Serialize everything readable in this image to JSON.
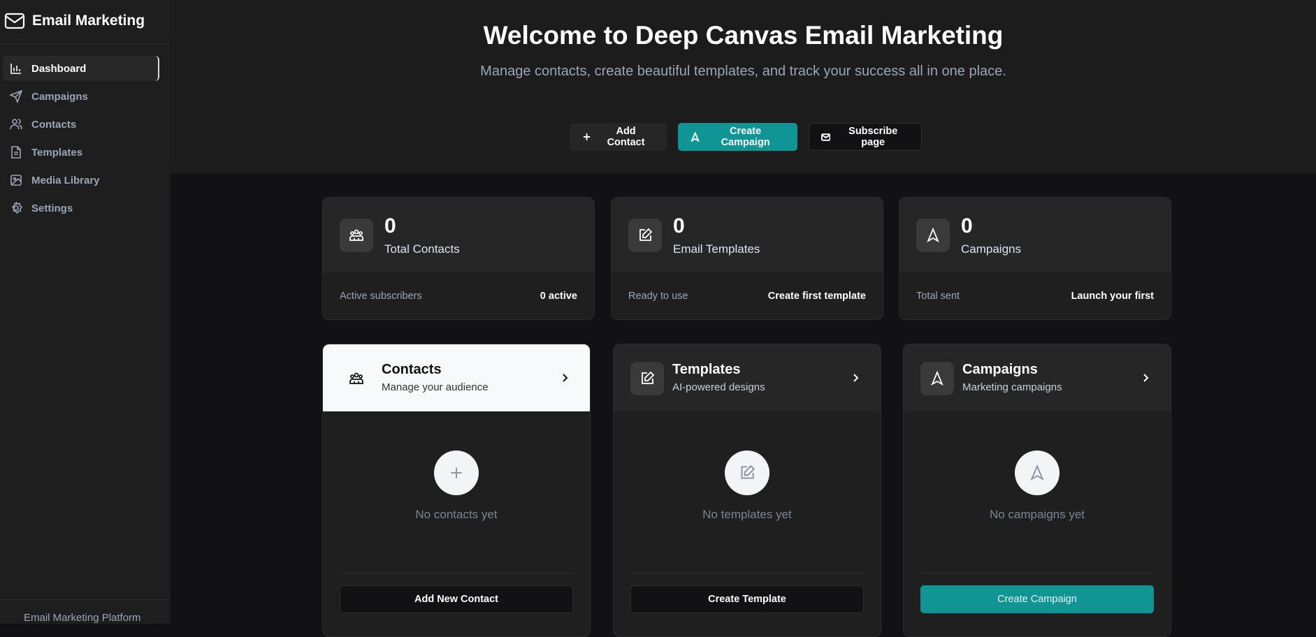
{
  "sidebar": {
    "brand": "Email Marketing",
    "items": [
      {
        "label": "Dashboard",
        "icon": "bar-chart-icon"
      },
      {
        "label": "Campaigns",
        "icon": "send-icon"
      },
      {
        "label": "Contacts",
        "icon": "users-icon"
      },
      {
        "label": "Templates",
        "icon": "file-text-icon"
      },
      {
        "label": "Media Library",
        "icon": "image-icon"
      },
      {
        "label": "Settings",
        "icon": "gear-icon"
      }
    ],
    "footer": "Email Marketing Platform"
  },
  "header": {
    "title": "Welcome to Deep Canvas Email Marketing",
    "subtitle": "Manage contacts, create beautiful templates, and track your success all in one place.",
    "buttons": {
      "add_contact": "Add Contact",
      "create_campaign": "Create Campaign",
      "subscribe": "Subscribe page"
    }
  },
  "stats": [
    {
      "value": "0",
      "label": "Total Contacts",
      "footer_left": "Active subscribers",
      "footer_right": "0 active"
    },
    {
      "value": "0",
      "label": "Email Templates",
      "footer_left": "Ready to use",
      "footer_right": "Create first template"
    },
    {
      "value": "0",
      "label": "Campaigns",
      "footer_left": "Total sent",
      "footer_right": "Launch your first"
    }
  ],
  "panels": [
    {
      "title": "Contacts",
      "subtitle": "Manage your audience",
      "empty": "No contacts yet",
      "button": "Add New Contact"
    },
    {
      "title": "Templates",
      "subtitle": "AI-powered designs",
      "empty": "No templates yet",
      "button": "Create Template"
    },
    {
      "title": "Campaigns",
      "subtitle": "Marketing campaigns",
      "empty": "No campaigns yet",
      "button": "Create Campaign"
    }
  ],
  "colors": {
    "accent": "#109494"
  }
}
